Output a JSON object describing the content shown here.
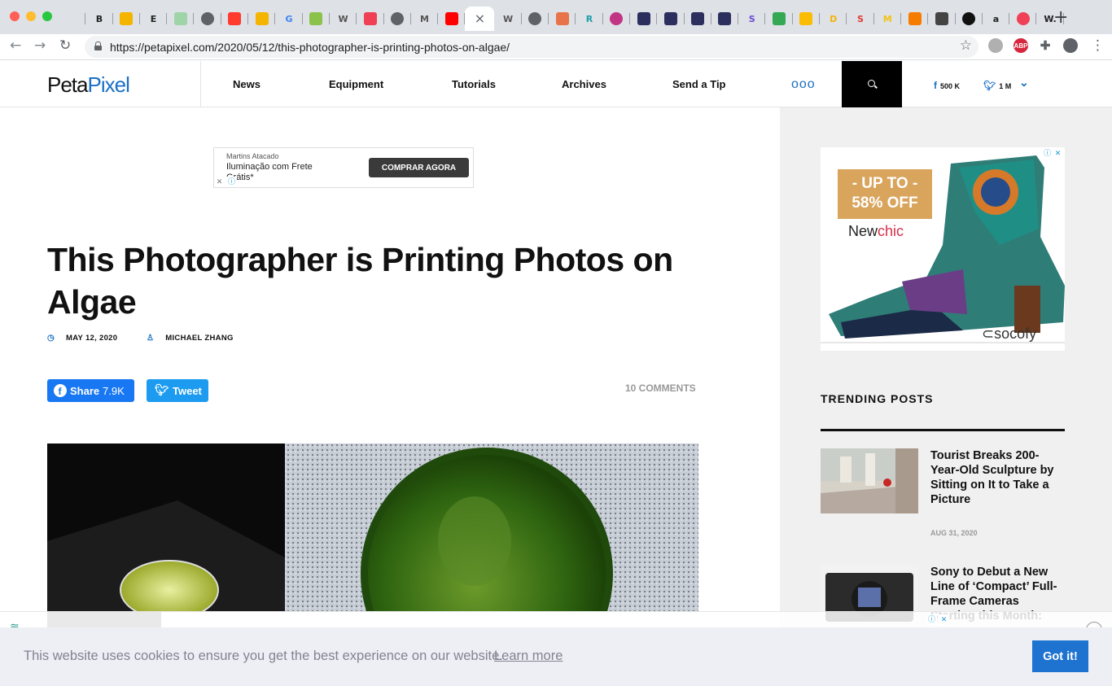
{
  "browser": {
    "tabs": [
      {
        "icon": "window-icon",
        "glyph": "",
        "color": "#dee1e6"
      },
      {
        "icon": "bold-b-icon",
        "glyph": "B",
        "color": "#222222"
      },
      {
        "icon": "slides-icon",
        "glyph": "",
        "color": "#f4b400"
      },
      {
        "icon": "e-icon",
        "glyph": "E",
        "color": "#222222"
      },
      {
        "icon": "sheets-icon",
        "glyph": "",
        "color": "#9fd3a8"
      },
      {
        "icon": "globe-icon",
        "glyph": "",
        "color": "#5f6368"
      },
      {
        "icon": "opera-icon",
        "glyph": "",
        "color": "#ff3b30"
      },
      {
        "icon": "infinity-icon",
        "glyph": "",
        "color": "#f4b400"
      },
      {
        "icon": "google-icon",
        "glyph": "G",
        "color": "#4285f4"
      },
      {
        "icon": "green-app-icon",
        "glyph": "",
        "color": "#8bc34a"
      },
      {
        "icon": "wikipedia-icon",
        "glyph": "W",
        "color": "#555555"
      },
      {
        "icon": "pocket-icon",
        "glyph": "",
        "color": "#ef4056"
      },
      {
        "icon": "globe-icon",
        "glyph": "",
        "color": "#5f6368"
      },
      {
        "icon": "medium-icon",
        "glyph": "M",
        "color": "#555555"
      },
      {
        "icon": "youtube-icon",
        "glyph": "",
        "color": "#ff0000"
      },
      {
        "icon": "close-tab-icon",
        "glyph": "×",
        "color": "#5f6368",
        "active": true
      },
      {
        "icon": "wikipedia-icon",
        "glyph": "W",
        "color": "#555555"
      },
      {
        "icon": "globe-icon",
        "glyph": "",
        "color": "#5f6368"
      },
      {
        "icon": "book-icon",
        "glyph": "",
        "color": "#e8734a"
      },
      {
        "icon": "r-icon",
        "glyph": "R",
        "color": "#1fa0a8"
      },
      {
        "icon": "instagram-icon",
        "glyph": "",
        "color": "#c13584"
      },
      {
        "icon": "vector-icon",
        "glyph": "",
        "color": "#2c2f5e"
      },
      {
        "icon": "vector-icon",
        "glyph": "",
        "color": "#2c2f5e"
      },
      {
        "icon": "vector-icon",
        "glyph": "",
        "color": "#2c2f5e"
      },
      {
        "icon": "vector-icon",
        "glyph": "",
        "color": "#2c2f5e"
      },
      {
        "icon": "s-purple-icon",
        "glyph": "S",
        "color": "#6c4ad6"
      },
      {
        "icon": "drive-icon",
        "glyph": "",
        "color": "#34a853"
      },
      {
        "icon": "drive-icon",
        "glyph": "",
        "color": "#fbbc04"
      },
      {
        "icon": "d-icon",
        "glyph": "D",
        "color": "#f4b400"
      },
      {
        "icon": "s-red-icon",
        "glyph": "S",
        "color": "#e53935"
      },
      {
        "icon": "m-yellow-icon",
        "glyph": "M",
        "color": "#f4c20d"
      },
      {
        "icon": "grid-orange-icon",
        "glyph": "",
        "color": "#f57c00"
      },
      {
        "icon": "diamond-icon",
        "glyph": "",
        "color": "#444444"
      },
      {
        "icon": "black-circle-icon",
        "glyph": "",
        "color": "#111111"
      },
      {
        "icon": "amazon-icon",
        "glyph": "a",
        "color": "#222222"
      },
      {
        "icon": "target-icon",
        "glyph": "",
        "color": "#ef4056"
      },
      {
        "icon": "w-icon",
        "glyph": "W.",
        "color": "#222222"
      }
    ],
    "new_tab": "+",
    "url": "https://petapixel.com/2020/05/12/this-photographer-is-printing-photos-on-algae/",
    "back": "←",
    "forward": "→",
    "reload": "↻",
    "star": "☆",
    "menu": "⋮"
  },
  "site": {
    "logo_a": "Peta",
    "logo_b": "Pixel",
    "nav": [
      "News",
      "Equipment",
      "Tutorials",
      "Archives",
      "Send a Tip"
    ],
    "more": "ooo",
    "facebook_count": "500 K",
    "twitter_count": "1 M",
    "chevron": "⌄"
  },
  "ad_top": {
    "advertiser": "Martins Atacado",
    "text": "Iluminação com Frete Grátis*",
    "cta": "COMPRAR AGORA"
  },
  "article": {
    "title": "This Photographer is Printing Photos on Algae",
    "date": "MAY 12, 2020",
    "author": "MICHAEL ZHANG",
    "share_label": "Share",
    "share_count": "7.9K",
    "tweet_label": "Tweet",
    "comments": "10 COMMENTS"
  },
  "ad_side": {
    "promo_line1": "- UP TO -",
    "promo_line2": "58% OFF",
    "brand_a": "New",
    "brand_b": "chic",
    "brand2": "socofy"
  },
  "sidebar": {
    "heading": "TRENDING POSTS",
    "posts": [
      {
        "title": "Tourist Breaks 200-Year-Old Sculpture by Sitting on It to Take a Picture",
        "date": "AUG 31, 2020"
      },
      {
        "title": "Sony to Debut a New Line of ‘Compact’ Full-Frame Cameras Starting this Month:",
        "date": ""
      }
    ]
  },
  "cookie": {
    "text": "This website uses cookies to ensure you get the best experience on our website.",
    "link": "Learn more",
    "button": "Got it!"
  }
}
